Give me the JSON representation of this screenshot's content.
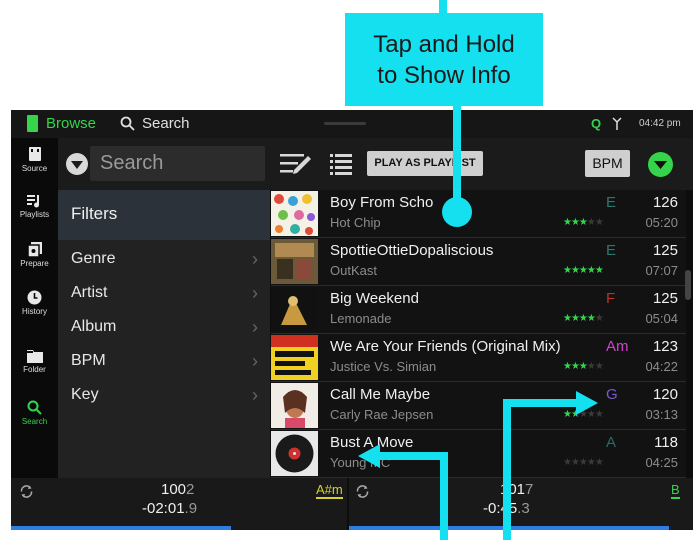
{
  "callout": {
    "line1": "Tap and Hold",
    "line2": "to Show Info"
  },
  "topbar": {
    "browse_label": "Browse",
    "search_label": "Search",
    "q_label": "Q",
    "time": "04:42 pm"
  },
  "nav": [
    {
      "label": "Source",
      "icon": "usb-drive-icon"
    },
    {
      "label": "Playlists",
      "icon": "playlist-icon"
    },
    {
      "label": "Prepare",
      "icon": "prepare-icon"
    },
    {
      "label": "History",
      "icon": "clock-icon"
    },
    {
      "label": "Folder",
      "icon": "folder-icon"
    },
    {
      "label": "Search",
      "icon": "search-icon"
    }
  ],
  "toolbar": {
    "search_placeholder": "Search",
    "play_as_playlist": "PLAY AS PLAYLIST",
    "sort_label": "BPM"
  },
  "filters": {
    "header": "Filters",
    "items": [
      "Genre",
      "Artist",
      "Album",
      "BPM",
      "Key"
    ]
  },
  "tracks": [
    {
      "title": "Boy From Scho",
      "artist": "Hot Chip",
      "key": "E",
      "key_color": "#2a7a6a",
      "bpm": "126",
      "duration": "05:20",
      "rating": 3
    },
    {
      "title": "SpottieOttieDopaliscious",
      "artist": "OutKast",
      "key": "E",
      "key_color": "#2a7a6a",
      "bpm": "125",
      "duration": "07:07",
      "rating": 5
    },
    {
      "title": "Big Weekend",
      "artist": "Lemonade",
      "key": "F",
      "key_color": "#b83232",
      "bpm": "125",
      "duration": "05:04",
      "rating": 4
    },
    {
      "title": "We Are Your Friends (Original Mix)",
      "artist": "Justice Vs. Simian",
      "key": "Am",
      "key_color": "#cc44cc",
      "bpm": "123",
      "duration": "04:22",
      "rating": 3
    },
    {
      "title": "Call Me Maybe",
      "artist": "Carly Rae Jepsen",
      "key": "G",
      "key_color": "#7a5acc",
      "bpm": "120",
      "duration": "03:13",
      "rating": 2
    },
    {
      "title": "Bust A Move",
      "artist": "Young MC",
      "key": "A",
      "key_color": "#2a6a6a",
      "bpm": "118",
      "duration": "04:25",
      "rating": 0
    }
  ],
  "deck_left": {
    "bpm_main": "100",
    "bpm_dec": "2",
    "time_main": "-02:01",
    "time_dec": ".9",
    "key": "A#m"
  },
  "deck_right": {
    "bpm_main": "101",
    "bpm_dec": "7",
    "time_main": "-0",
    "time_mid": ":45",
    "time_dec": ".3",
    "key": "B"
  },
  "colors": {
    "accent_green": "#35d44a",
    "callout_cyan": "#15e0f0",
    "deck_bar_blue": "#2f7de0"
  }
}
